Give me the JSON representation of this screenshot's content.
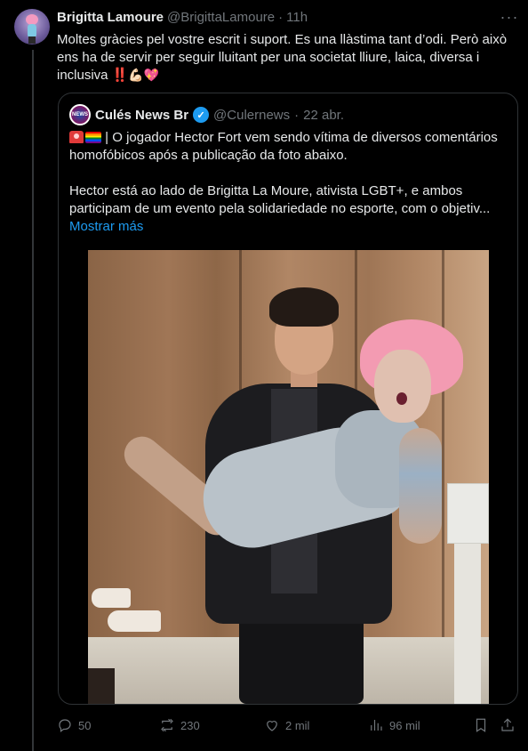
{
  "post": {
    "author_name": "Brigitta Lamoure",
    "author_handle": "@BrigittaLamoure",
    "separator": "·",
    "time": "11h",
    "text_main": "Moltes gràcies pel vostre escrit i suport. Es una llàstima tant d’odi. Però això ens ha de servir per seguir lluitant per una societat lliure, laica, diversa i inclusiva",
    "text_emoji_bang": "‼️",
    "text_emoji_arm": "💪🏻",
    "text_emoji_heart": "💖",
    "more_label": "···"
  },
  "quote": {
    "author_name": "Culés News Br",
    "avatar_text": "NEWS",
    "verified_mark": "✓",
    "author_handle": "@Culernews",
    "separator": "·",
    "time": "22 abr.",
    "para1": "| O jogador Hector Fort vem sendo vítima de diversos comentários homofóbicos após a publicação da foto abaixo.",
    "para2": "Hector está ao lado de Brigitta La Moure, ativista LGBT+, e ambos participam de um evento pela solidariedade no esporte, com o objetiv...",
    "show_more": "Mostrar más"
  },
  "actions": {
    "replies": "50",
    "reposts": "230",
    "likes": "2 mil",
    "views": "96 mil"
  },
  "icons": {
    "reply": "reply-icon",
    "repost": "repost-icon",
    "like": "heart-icon",
    "views": "views-icon",
    "bookmark": "bookmark-icon",
    "share": "share-icon"
  },
  "colors": {
    "background": "#000000",
    "text": "#e7e9ea",
    "muted": "#71767b",
    "link": "#1d9bf0",
    "border": "#2f3336"
  }
}
